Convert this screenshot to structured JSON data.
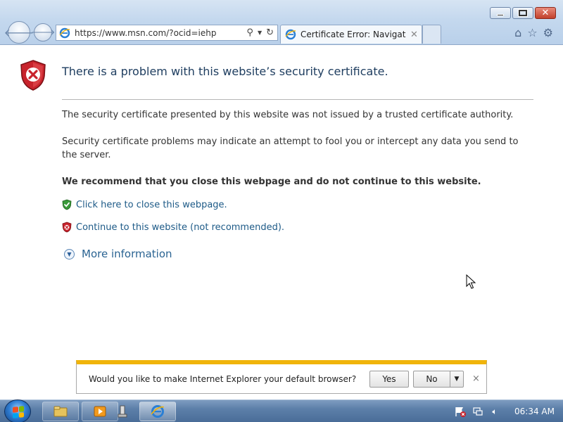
{
  "browser": {
    "address_url": "https://www.msn.com/?ocid=iehp",
    "tab_title": "Certificate Error: Navigatio...",
    "nav_icons": [
      "back-arrow-icon",
      "forward-arrow-icon",
      "search-icon",
      "refresh-icon",
      "home-icon",
      "favorites-star-icon",
      "gear-icon"
    ]
  },
  "page": {
    "heading": "There is a problem with this website’s security certificate.",
    "paragraph1": "The security certificate presented by this website was not issued by a trusted certificate authority.",
    "paragraph2": "Security certificate problems may indicate an attempt to fool you or intercept any data you send to the server.",
    "recommendation": "We recommend that you close this webpage and do not continue to this website.",
    "close_link": "Click here to close this webpage.",
    "continue_link": "Continue to this website (not recommended).",
    "more_info": "More information"
  },
  "notification": {
    "text": "Would you like to make Internet Explorer your default browser?",
    "yes_label": "Yes",
    "no_label": "No",
    "close_glyph": "×"
  },
  "taskbar": {
    "clock": "06:34 AM",
    "pinned": [
      "file-explorer-icon",
      "media-player-icon",
      "app-icon",
      "internet-explorer-icon"
    ]
  },
  "colors": {
    "heading": "#1f3e60",
    "link": "#1d5a87",
    "notify_accent": "#f0b40b",
    "shield_red": "#c8232c",
    "shield_green": "#3a9a3a"
  }
}
